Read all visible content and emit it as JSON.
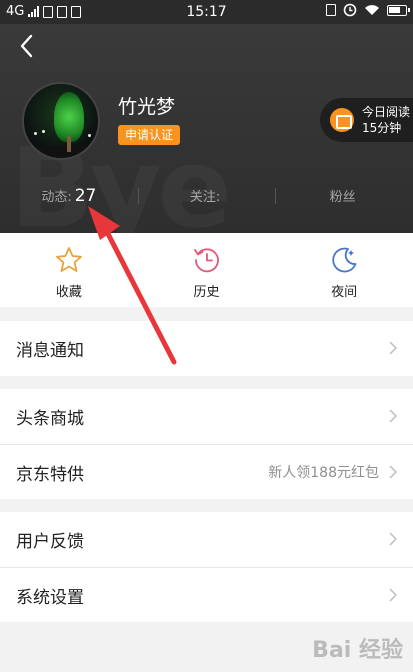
{
  "status_bar": {
    "network": "4G",
    "time": "15:17"
  },
  "header": {
    "username": "竹光梦",
    "cert_label": "申请认证",
    "reading": {
      "line1": "今日阅读",
      "line2": "15分钟"
    },
    "stats": [
      {
        "label": "动态:",
        "value": "27"
      },
      {
        "label": "关注:",
        "value": ""
      },
      {
        "label": "粉丝",
        "value": ""
      }
    ]
  },
  "shortcuts": [
    {
      "label": "收藏",
      "icon": "star-icon",
      "color": "#e8a33d"
    },
    {
      "label": "历史",
      "icon": "clock-history-icon",
      "color": "#e05a7a"
    },
    {
      "label": "夜间",
      "icon": "moon-icon",
      "color": "#4a76c9"
    }
  ],
  "menu": {
    "notifications": "消息通知",
    "mall": "头条商城",
    "jd": {
      "label": "京东特供",
      "hint": "新人领188元红包"
    },
    "feedback": "用户反馈",
    "settings": "系统设置"
  },
  "colors": {
    "accent": "#f7931e",
    "annotation_arrow": "#e8363a"
  },
  "watermark": "Bai 经验"
}
